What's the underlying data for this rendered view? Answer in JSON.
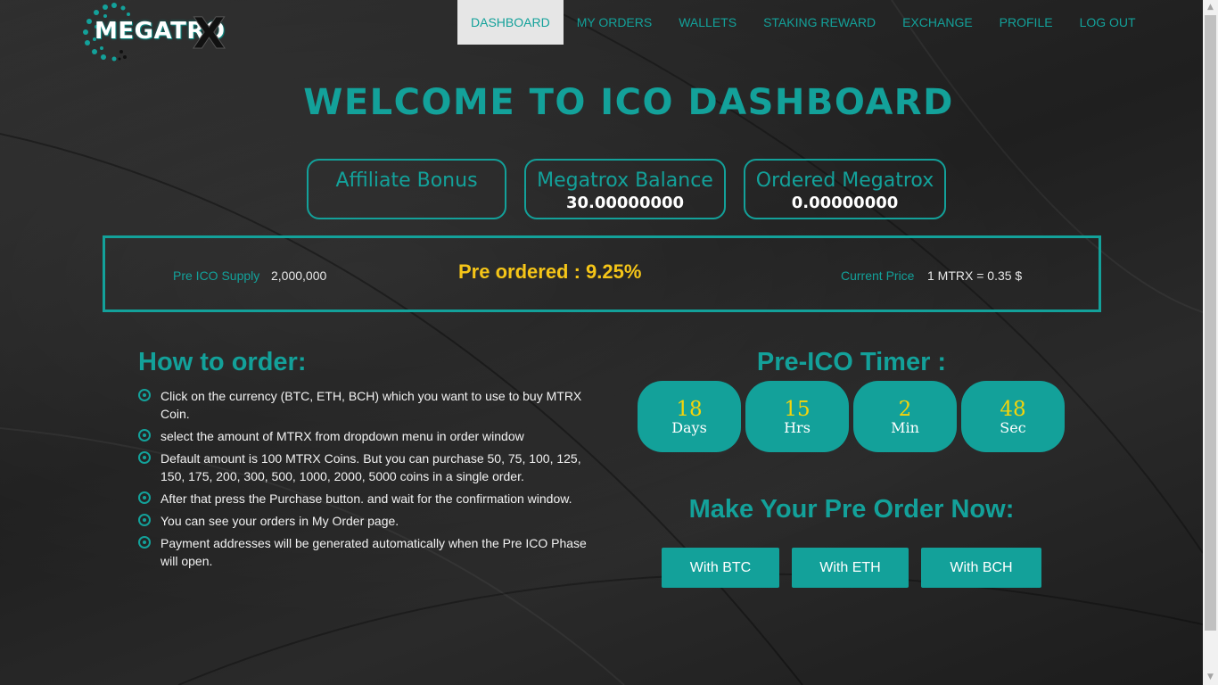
{
  "brand": {
    "logo_text": "MEGATRO",
    "logo_x": "X"
  },
  "nav": {
    "items": [
      {
        "label": "DASHBOARD"
      },
      {
        "label": "MY ORDERS"
      },
      {
        "label": "WALLETS"
      },
      {
        "label": "STAKING REWARD"
      },
      {
        "label": "EXCHANGE"
      },
      {
        "label": "PROFILE"
      },
      {
        "label": "LOG OUT"
      }
    ],
    "active": "DASHBOARD"
  },
  "welcome_title": "WELCOME TO ICO DASHBOARD",
  "cards": {
    "affiliate": {
      "title": "Affiliate Bonus",
      "value": ""
    },
    "balance": {
      "title": "Megatrox Balance",
      "value": "30.00000000"
    },
    "ordered": {
      "title": "Ordered Megatrox",
      "value": "0.00000000"
    }
  },
  "supply": {
    "pre_ico_label": "Pre ICO Supply",
    "pre_ico_value": "2,000,000",
    "preordered_text": "Pre ordered : 9.25%",
    "price_label": "Current Price",
    "price_value": "1 MTRX = 0.35 $"
  },
  "how_to": {
    "title": "How to order:",
    "steps": [
      "Click on the currency (BTC, ETH, BCH) which you want to use to buy MTRX Coin.",
      "select the amount of MTRX from dropdown menu in order window",
      "Default amount is 100 MTRX Coins. But you can purchase 50, 75, 100, 125, 150, 175, 200, 300, 500, 1000, 2000, 5000 coins in a single order.",
      "After that press the Purchase button. and wait for the confirmation window.",
      "You can see your orders in My Order page.",
      "Payment addresses will be generated automatically when the Pre ICO Phase will open."
    ]
  },
  "timer": {
    "title": "Pre-ICO Timer :",
    "units": [
      {
        "num": "18",
        "unit": "Days"
      },
      {
        "num": "15",
        "unit": "Hrs"
      },
      {
        "num": "2",
        "unit": "Min"
      },
      {
        "num": "48",
        "unit": "Sec"
      }
    ]
  },
  "preorder": {
    "title": "Make Your Pre Order Now:",
    "buttons": [
      {
        "label": "With BTC"
      },
      {
        "label": "With ETH"
      },
      {
        "label": "With BCH"
      }
    ]
  },
  "colors": {
    "accent": "#13a19a",
    "highlight": "#f5c518",
    "background": "#262626"
  },
  "icons": {
    "step_bullet": "target-circle-icon",
    "scroll_up": "triangle-up",
    "scroll_down": "triangle-down"
  }
}
